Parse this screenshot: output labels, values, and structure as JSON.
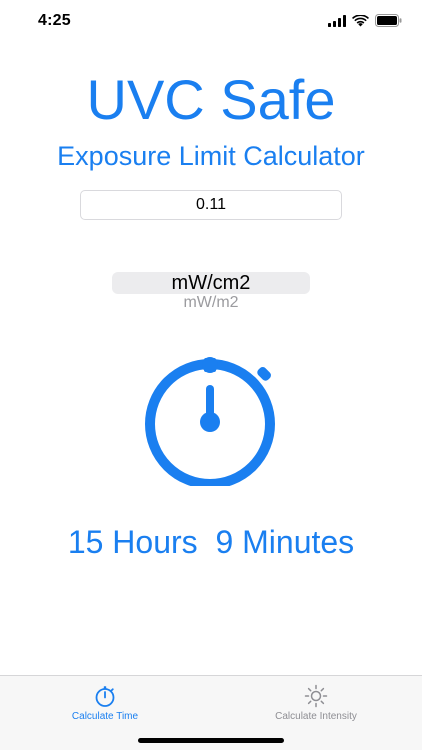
{
  "status_bar": {
    "time": "4:25"
  },
  "header": {
    "title": "UVC Safe",
    "subtitle": "Exposure Limit Calculator"
  },
  "input": {
    "value": "0.11"
  },
  "unit_picker": {
    "selected": "mW/cm2",
    "options": [
      "mW/cm2",
      "mW/m2"
    ],
    "next_option": "mW/m2"
  },
  "result": {
    "text": "15 Hours  9 Minutes"
  },
  "tab_bar": {
    "tabs": [
      {
        "label": "Calculate Time",
        "icon": "stopwatch-icon",
        "active": true
      },
      {
        "label": "Calculate Intensity",
        "icon": "sun-icon",
        "active": false
      }
    ]
  },
  "colors": {
    "accent": "#1a7ff0",
    "inactive": "#8e8e93",
    "background": "#ffffff",
    "tab_bar_background": "#f7f7f7"
  }
}
